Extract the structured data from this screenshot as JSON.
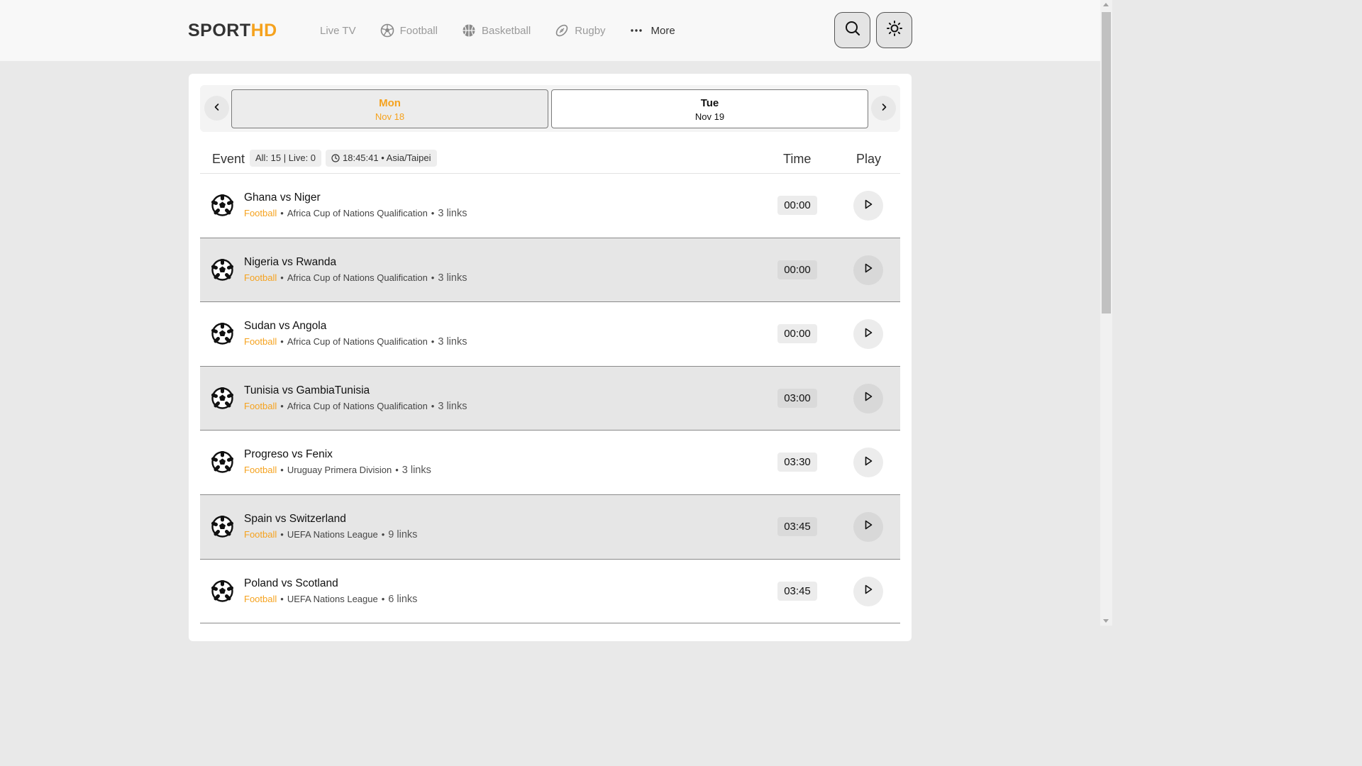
{
  "header": {
    "logo": {
      "part1": "SPORT",
      "part2": "HD"
    },
    "nav": [
      {
        "label": "Live TV",
        "icon": "none"
      },
      {
        "label": "Football",
        "icon": "football-icon"
      },
      {
        "label": "Basketball",
        "icon": "basketball-icon"
      },
      {
        "label": "Rugby",
        "icon": "rugby-icon"
      },
      {
        "label": "More",
        "icon": "more-dots-icon"
      }
    ]
  },
  "dates": [
    {
      "day": "Mon",
      "date": "Nov 18",
      "selected": true
    },
    {
      "day": "Tue",
      "date": "Nov 19",
      "selected": false
    }
  ],
  "table": {
    "event_label": "Event",
    "count_pill": "All: 15 | Live: 0",
    "clock_pill": "18:45:41 • Asia/Taipei",
    "time_label": "Time",
    "play_label": "Play"
  },
  "events": [
    {
      "title": "Ghana vs Niger",
      "sport": "Football",
      "league": "Africa Cup of Nations Qualification",
      "links": "3 links",
      "time": "00:00"
    },
    {
      "title": "Nigeria vs Rwanda",
      "sport": "Football",
      "league": "Africa Cup of Nations Qualification",
      "links": "3 links",
      "time": "00:00"
    },
    {
      "title": "Sudan vs Angola",
      "sport": "Football",
      "league": "Africa Cup of Nations Qualification",
      "links": "3 links",
      "time": "00:00"
    },
    {
      "title": "Tunisia vs GambiaTunisia",
      "sport": "Football",
      "league": "Africa Cup of Nations Qualification",
      "links": "3 links",
      "time": "03:00"
    },
    {
      "title": "Progreso vs Fenix",
      "sport": "Football",
      "league": "Uruguay Primera Division",
      "links": "3 links",
      "time": "03:30"
    },
    {
      "title": "Spain vs Switzerland",
      "sport": "Football",
      "league": "UEFA Nations League",
      "links": "9 links",
      "time": "03:45"
    },
    {
      "title": "Poland vs Scotland",
      "sport": "Football",
      "league": "UEFA Nations League",
      "links": "6 links",
      "time": "03:45"
    }
  ],
  "colors": {
    "accent": "#f5a21e",
    "alt_row": "#e6e6e6",
    "page_bg": "#e9e9e9"
  }
}
